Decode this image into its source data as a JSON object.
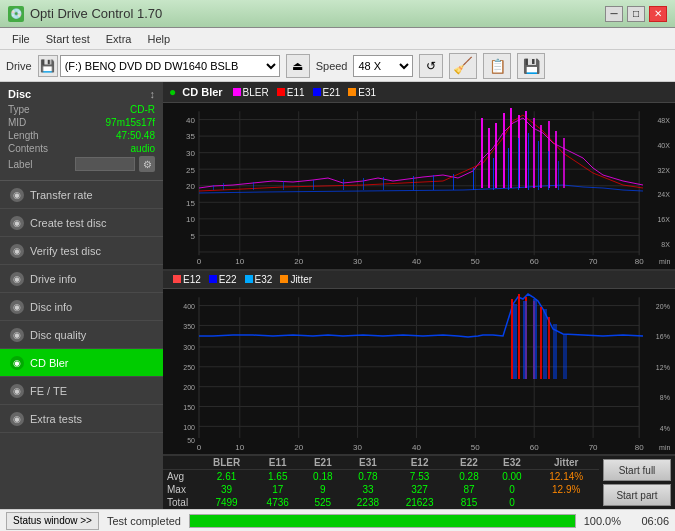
{
  "titlebar": {
    "icon": "💿",
    "title": "Opti Drive Control 1.70",
    "min_label": "─",
    "max_label": "□",
    "close_label": "✕"
  },
  "menubar": {
    "items": [
      "File",
      "Start test",
      "Extra",
      "Help"
    ]
  },
  "drivebar": {
    "drive_label": "Drive",
    "drive_value": "(F:)  BENQ DVD DD DW1640 BSLB",
    "speed_label": "Speed",
    "speed_value": "48 X",
    "eject_icon": "⏏",
    "refresh_icon": "↺",
    "eraser_icon": "🧹",
    "copy_icon": "📋",
    "save_icon": "💾"
  },
  "disc_panel": {
    "title": "Disc",
    "arrow": "↕",
    "rows": [
      {
        "label": "Type",
        "value": "CD-R",
        "color": "green"
      },
      {
        "label": "MID",
        "value": "97m15s17f",
        "color": "green"
      },
      {
        "label": "Length",
        "value": "47:50.48",
        "color": "green"
      },
      {
        "label": "Contents",
        "value": "audio",
        "color": "green"
      },
      {
        "label": "Label",
        "value": "",
        "color": "white"
      }
    ]
  },
  "sidebar": {
    "items": [
      {
        "id": "transfer-rate",
        "label": "Transfer rate",
        "active": false
      },
      {
        "id": "create-test-disc",
        "label": "Create test disc",
        "active": false
      },
      {
        "id": "verify-test-disc",
        "label": "Verify test disc",
        "active": false
      },
      {
        "id": "drive-info",
        "label": "Drive info",
        "active": false
      },
      {
        "id": "disc-info",
        "label": "Disc info",
        "active": false
      },
      {
        "id": "disc-quality",
        "label": "Disc quality",
        "active": false
      },
      {
        "id": "cd-bler",
        "label": "CD Bler",
        "active": true
      },
      {
        "id": "fe-te",
        "label": "FE / TE",
        "active": false
      },
      {
        "id": "extra-tests",
        "label": "Extra tests",
        "active": false
      }
    ]
  },
  "chart1": {
    "title": "CD Bler",
    "legend": [
      {
        "label": "BLER",
        "color": "#ff00ff"
      },
      {
        "label": "E11",
        "color": "#ff0000"
      },
      {
        "label": "E21",
        "color": "#0000ff"
      },
      {
        "label": "E31",
        "color": "#ff8800"
      }
    ],
    "y_max": 40,
    "y_labels": [
      "40",
      "35",
      "30",
      "25",
      "20",
      "15",
      "10",
      "5"
    ],
    "x_labels": [
      "0",
      "10",
      "20",
      "30",
      "40",
      "50",
      "60",
      "70",
      "80"
    ],
    "right_labels": [
      "48X",
      "40X",
      "32X",
      "24X",
      "16X",
      "8X"
    ],
    "right_label_header": "48 X"
  },
  "chart2": {
    "legend": [
      {
        "label": "E12",
        "color": "#ff0000"
      },
      {
        "label": "E22",
        "color": "#0000ff"
      },
      {
        "label": "E32",
        "color": "#00aaff"
      },
      {
        "label": "Jitter",
        "color": "#ff8800"
      }
    ],
    "y_labels": [
      "400",
      "350",
      "300",
      "250",
      "200",
      "150",
      "100",
      "50"
    ],
    "x_labels": [
      "0",
      "10",
      "20",
      "30",
      "40",
      "50",
      "60",
      "70",
      "80"
    ],
    "right_labels": [
      "20%",
      "16%",
      "12%",
      "8%",
      "4%"
    ]
  },
  "stats": {
    "headers": [
      "BLER",
      "E11",
      "E21",
      "E31",
      "E12",
      "E22",
      "E32",
      "Jitter"
    ],
    "rows": [
      {
        "label": "Avg",
        "values": [
          "2.61",
          "1.65",
          "0.18",
          "0.78",
          "7.53",
          "0.28",
          "0.00",
          "12.14%"
        ]
      },
      {
        "label": "Max",
        "values": [
          "39",
          "17",
          "9",
          "33",
          "327",
          "87",
          "0",
          "12.9%"
        ]
      },
      {
        "label": "Total",
        "values": [
          "7499",
          "4736",
          "525",
          "2238",
          "21623",
          "815",
          "0",
          ""
        ]
      }
    ],
    "buttons": {
      "start_full": "Start full",
      "start_part": "Start part"
    }
  },
  "statusbar": {
    "window_btn": "Status window >>",
    "status_text": "Test completed",
    "progress": 100,
    "progress_text": "100.0%",
    "time": "06:06"
  }
}
